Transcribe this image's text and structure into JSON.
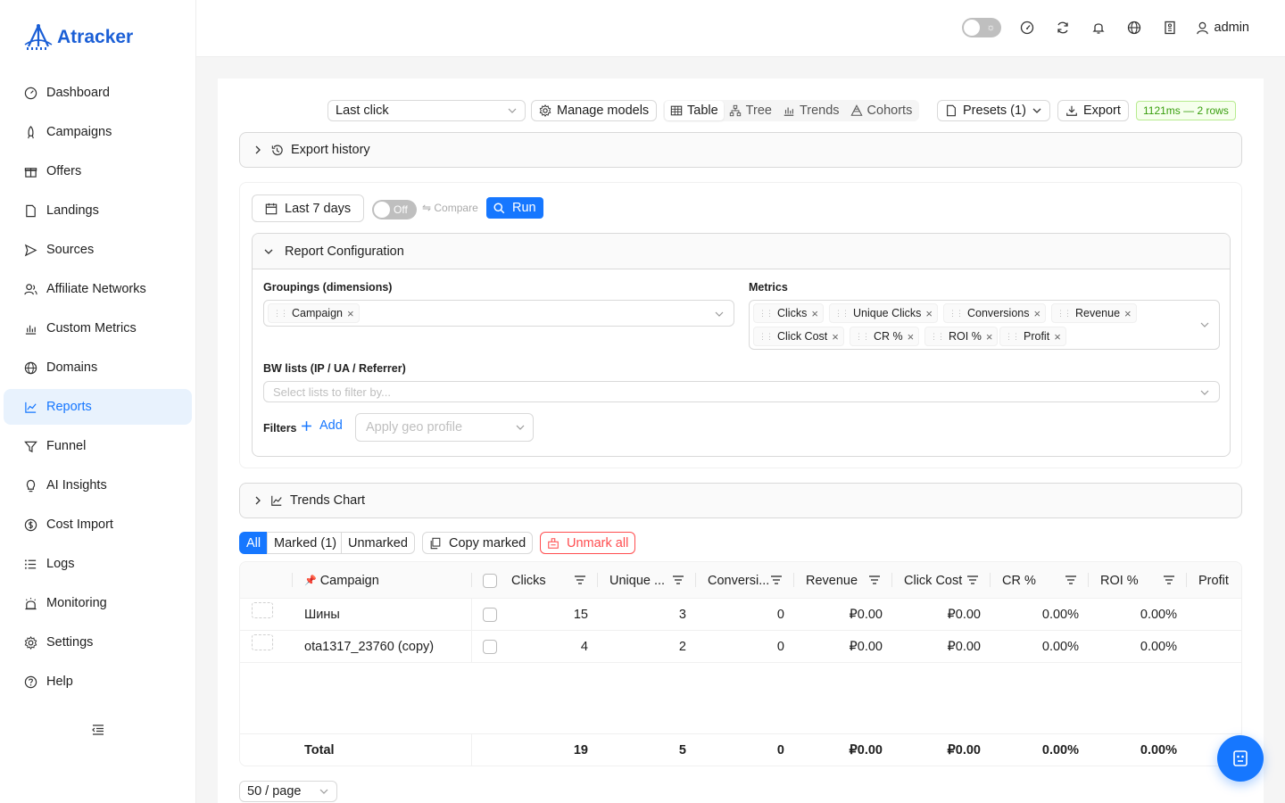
{
  "app": {
    "name": "Atracker"
  },
  "sidebar": {
    "items": [
      {
        "label": "Dashboard",
        "icon": "dashboard-icon"
      },
      {
        "label": "Campaigns",
        "icon": "rocket-icon"
      },
      {
        "label": "Offers",
        "icon": "gift-icon"
      },
      {
        "label": "Landings",
        "icon": "file-icon"
      },
      {
        "label": "Sources",
        "icon": "send-icon"
      },
      {
        "label": "Affiliate Networks",
        "icon": "users-icon"
      },
      {
        "label": "Custom Metrics",
        "icon": "bar-chart-icon"
      },
      {
        "label": "Domains",
        "icon": "globe-icon"
      },
      {
        "label": "Reports",
        "icon": "line-chart-icon",
        "active": true
      },
      {
        "label": "Funnel",
        "icon": "funnel-icon"
      },
      {
        "label": "AI Insights",
        "icon": "bulb-icon"
      },
      {
        "label": "Cost Import",
        "icon": "dollar-icon"
      },
      {
        "label": "Logs",
        "icon": "list-icon"
      },
      {
        "label": "Monitoring",
        "icon": "monitor-icon"
      },
      {
        "label": "Settings",
        "icon": "gear-icon"
      },
      {
        "label": "Help",
        "icon": "help-icon"
      }
    ]
  },
  "header": {
    "user": "admin"
  },
  "toolbar": {
    "attribution": "Last click",
    "manage_models": "Manage models",
    "views": [
      "Table",
      "Tree",
      "Trends",
      "Cohorts"
    ],
    "active_view": "Table",
    "presets": "Presets (1)",
    "export": "Export",
    "timing": "1121ms — 2 rows"
  },
  "export_history": {
    "label": "Export history"
  },
  "report": {
    "date_range": "Last 7 days",
    "toggle": "Off",
    "compare": "⇋ Compare",
    "run": "Run",
    "config_title": "Report Configuration",
    "groupings_label": "Groupings (dimensions)",
    "groupings": [
      "Campaign"
    ],
    "metrics_label": "Metrics",
    "metrics": [
      "Clicks",
      "Unique Clicks",
      "Conversions",
      "Revenue",
      "Click Cost",
      "CR %",
      "ROI %",
      "Profit"
    ],
    "bw_label": "BW lists (IP / UA / Referrer)",
    "bw_placeholder": "Select lists to filter by...",
    "filters_label": "Filters",
    "add_label": "Add",
    "geo_placeholder": "Apply geo profile"
  },
  "trends": {
    "label": "Trends Chart"
  },
  "filter_tabs": {
    "all": "All",
    "marked": "Marked (1)",
    "unmarked": "Unmarked",
    "copy": "Copy marked",
    "unmark": "Unmark all"
  },
  "table": {
    "columns": [
      "Campaign",
      "Clicks",
      "Unique ...",
      "Conversi...",
      "Revenue",
      "Click Cost",
      "CR %",
      "ROI %",
      "Profit"
    ],
    "rows": [
      {
        "campaign": "Шины",
        "clicks": "15",
        "unique": "3",
        "conversions": "0",
        "revenue": "₽0.00",
        "cost": "₽0.00",
        "cr": "0.00%",
        "roi": "0.00%"
      },
      {
        "campaign": "ota1317_23760 (copy)",
        "clicks": "4",
        "unique": "2",
        "conversions": "0",
        "revenue": "₽0.00",
        "cost": "₽0.00",
        "cr": "0.00%",
        "roi": "0.00%"
      }
    ],
    "total": {
      "label": "Total",
      "clicks": "19",
      "unique": "5",
      "conversions": "0",
      "revenue": "₽0.00",
      "cost": "₽0.00",
      "cr": "0.00%",
      "roi": "0.00%"
    }
  },
  "pagination": {
    "page_size": "50 / page"
  },
  "colors": {
    "accent": "#1677ff",
    "brand": "#1b5fd6",
    "danger": "#ff4d4f",
    "success": "#389e0d"
  }
}
